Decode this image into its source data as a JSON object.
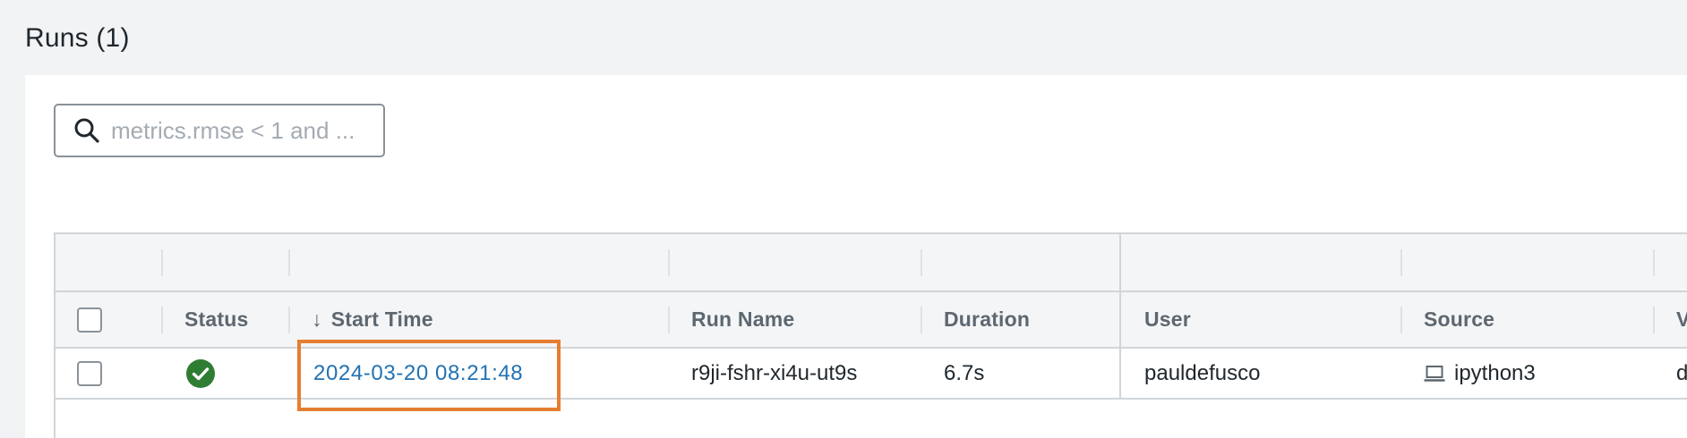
{
  "page": {
    "title": "Runs (1)"
  },
  "search": {
    "placeholder": "metrics.rmse < 1 and ...",
    "value": ""
  },
  "table": {
    "columns": {
      "status": "Status",
      "start_time": "Start Time",
      "sort_arrow": "↓",
      "run_name": "Run Name",
      "duration": "Duration",
      "user": "User",
      "source": "Source",
      "version": "Ver"
    },
    "rows": [
      {
        "status": "success",
        "start_time": "2024-03-20 08:21:48",
        "run_name": "r9ji-fshr-xi4u-ut9s",
        "duration": "6.7s",
        "user": "pauldefusco",
        "source": "ipython3",
        "version": "ddc"
      }
    ]
  },
  "colors": {
    "accent_link": "#2272b4",
    "success": "#2e7d32",
    "highlight": "#e67e32"
  },
  "icons": {
    "search": "search-icon",
    "status": "check-circle-icon",
    "source": "laptop-icon"
  }
}
